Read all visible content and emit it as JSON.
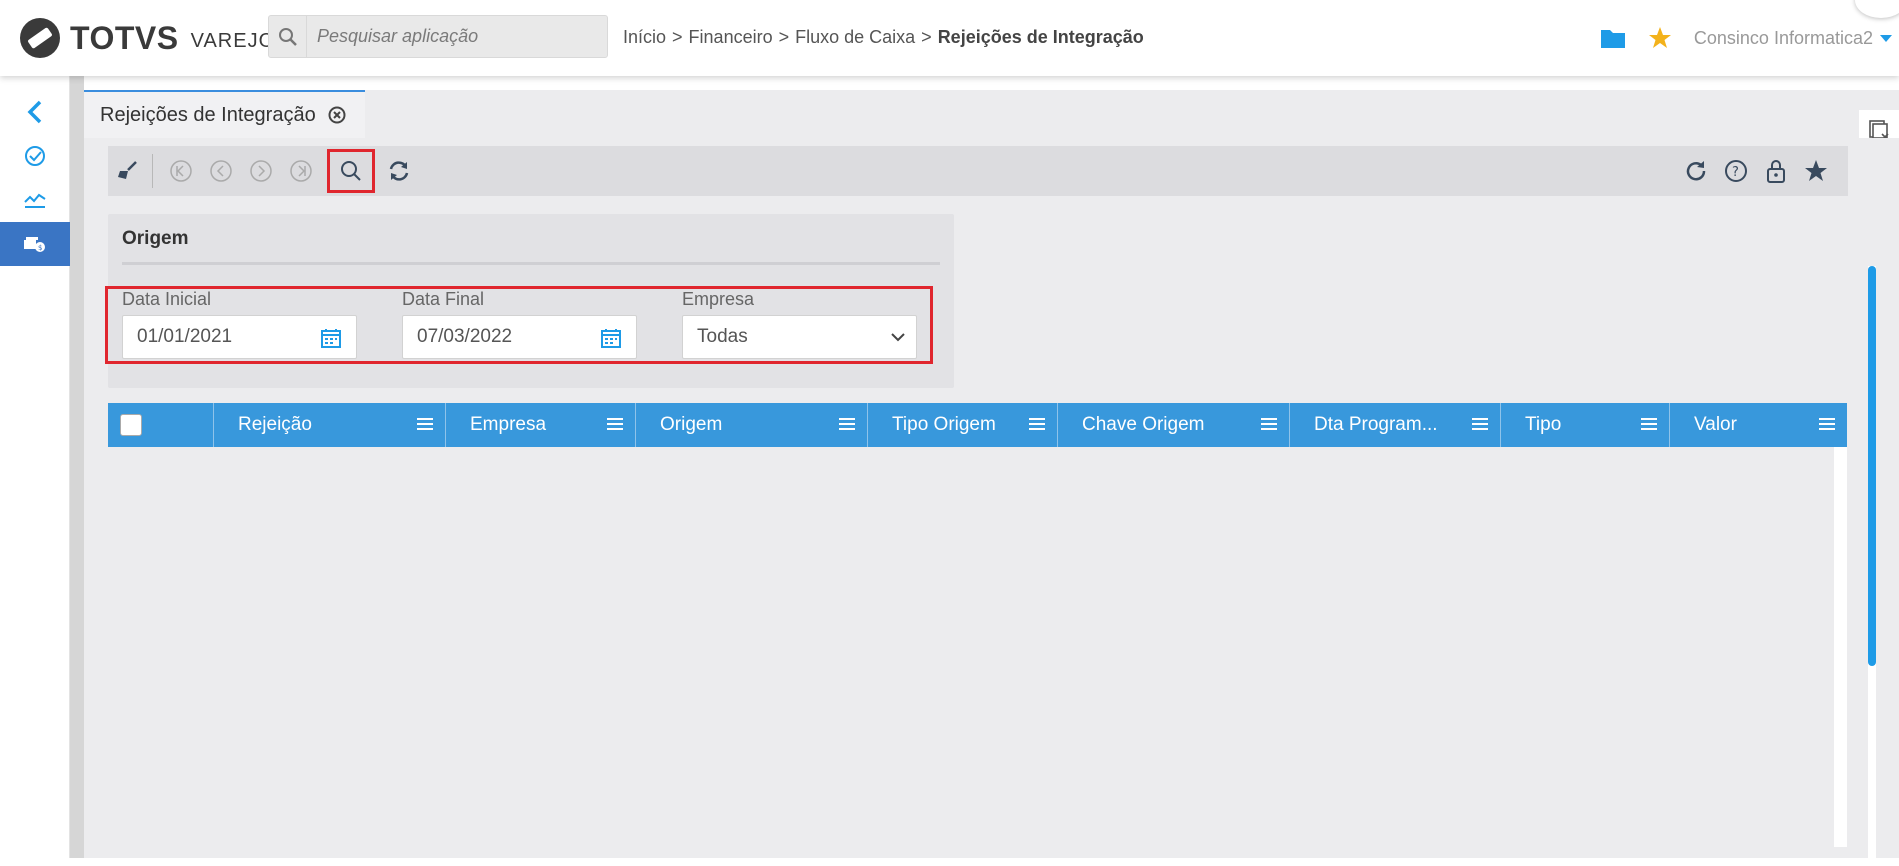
{
  "brand": {
    "name": "TOTVS",
    "product": "VAREJO"
  },
  "search": {
    "placeholder": "Pesquisar aplicação",
    "icon": "search-icon"
  },
  "breadcrumb": {
    "items": [
      "Início",
      "Financeiro",
      "Fluxo de Caixa"
    ],
    "separator": ">",
    "current": "Rejeições de Integração"
  },
  "header": {
    "user": "Consinco Informatica2"
  },
  "sidebar": {
    "items": [
      {
        "icon": "chevron-left-icon"
      },
      {
        "icon": "check-circle-icon"
      },
      {
        "icon": "trend-line-icon"
      },
      {
        "icon": "money-icon",
        "active": true
      }
    ]
  },
  "tab": {
    "label": "Rejeições de Integração"
  },
  "toolbar": {
    "left": [
      "clean-icon",
      "first-icon",
      "previous-icon",
      "next-icon",
      "last-icon",
      "search-icon",
      "refresh-icon"
    ],
    "right": [
      "reload-icon",
      "help-icon",
      "lock-icon",
      "favorite-icon"
    ]
  },
  "origem": {
    "title": "Origem",
    "data_inicial": {
      "label": "Data Inicial",
      "value": "01/01/2021"
    },
    "data_final": {
      "label": "Data Final",
      "value": "07/03/2022"
    },
    "empresa": {
      "label": "Empresa",
      "value": "Todas"
    }
  },
  "grid": {
    "columns": [
      "Rejeição",
      "Empresa",
      "Origem",
      "Tipo Origem",
      "Chave Origem",
      "Dta Program...",
      "Tipo",
      "Valor"
    ]
  },
  "colors": {
    "accent": "#3898dc",
    "highlight": "#e0262e",
    "active_sidebar": "#3a75c4"
  }
}
